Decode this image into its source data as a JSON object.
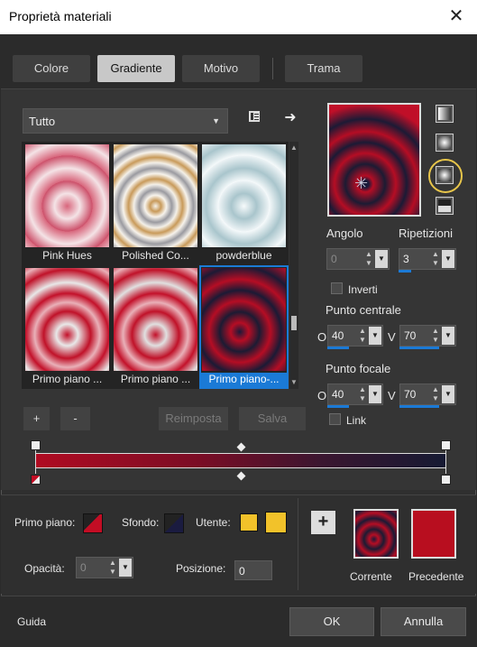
{
  "window": {
    "title": "Proprietà materiali",
    "close": "✕"
  },
  "tabs": [
    {
      "label": "Colore",
      "active": false
    },
    {
      "label": "Gradiente",
      "active": true
    },
    {
      "label": "Motivo",
      "active": false
    },
    {
      "label": "Trama",
      "active": false
    }
  ],
  "library": {
    "filter": "Tutto",
    "items": [
      {
        "label": "Pink Hues"
      },
      {
        "label": "Polished Co..."
      },
      {
        "label": "powderblue"
      },
      {
        "label": "Primo piano ..."
      },
      {
        "label": "Primo piano ..."
      },
      {
        "label": "Primo piano-...",
        "selected": true
      }
    ],
    "add_label": "+",
    "remove_label": "-",
    "reset_label": "Reimposta",
    "save_label": "Salva"
  },
  "gradient": {
    "angle_label": "Angolo",
    "angle_value": "0",
    "repeats_label": "Ripetizioni",
    "repeats_value": "3",
    "invert_label": "Inverti",
    "center_label": "Punto centrale",
    "center_o": "40",
    "center_v": "70",
    "focal_label": "Punto focale",
    "focal_o": "40",
    "focal_v": "70",
    "link_label": "Link",
    "o_label": "O",
    "v_label": "V",
    "colors": {
      "start": "#b00b22",
      "end": "#161a33"
    }
  },
  "materials": {
    "foreground_label": "Primo piano:",
    "background_label": "Sfondo:",
    "user_label": "Utente:",
    "opacity_label": "Opacità:",
    "opacity_value": "0",
    "position_label": "Posizione:",
    "position_value": "0",
    "current_label": "Corrente",
    "previous_label": "Precedente",
    "user_color": "#f2c22a",
    "previous_color": "#b80e1f"
  },
  "footer": {
    "help_label": "Guida",
    "ok_label": "OK",
    "cancel_label": "Annulla"
  }
}
